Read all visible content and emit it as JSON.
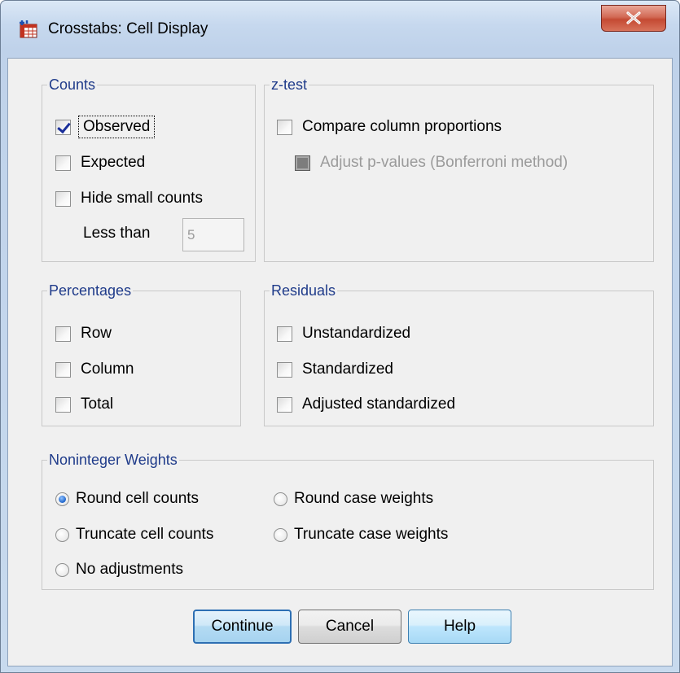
{
  "window": {
    "title": "Crosstabs: Cell Display",
    "close_icon": "close-icon"
  },
  "counts": {
    "legend": "Counts",
    "observed": {
      "label": "Observed",
      "checked": true
    },
    "expected": {
      "label": "Expected",
      "checked": false
    },
    "hide_small": {
      "label": "Hide small counts",
      "checked": false
    },
    "less_than_label": "Less than",
    "less_than_value": "5"
  },
  "ztest": {
    "legend": "z-test",
    "compare": {
      "label": "Compare column proportions",
      "checked": false
    },
    "adjust": {
      "label": "Adjust p-values (Bonferroni method)",
      "checked": false,
      "enabled": false
    }
  },
  "percentages": {
    "legend": "Percentages",
    "row": {
      "label": "Row",
      "checked": false
    },
    "column": {
      "label": "Column",
      "checked": false
    },
    "total": {
      "label": "Total",
      "checked": false
    }
  },
  "residuals": {
    "legend": "Residuals",
    "unstandardized": {
      "label": "Unstandardized",
      "checked": false
    },
    "standardized": {
      "label": "Standardized",
      "checked": false
    },
    "adjusted": {
      "label": "Adjusted standardized",
      "checked": false
    }
  },
  "noninteger": {
    "legend": "Noninteger Weights",
    "options": [
      {
        "label": "Round cell counts",
        "selected": true
      },
      {
        "label": "Round case weights",
        "selected": false
      },
      {
        "label": "Truncate cell counts",
        "selected": false
      },
      {
        "label": "Truncate case weights",
        "selected": false
      },
      {
        "label": "No adjustments",
        "selected": false
      }
    ]
  },
  "buttons": {
    "continue": "Continue",
    "cancel": "Cancel",
    "help": "Help"
  }
}
